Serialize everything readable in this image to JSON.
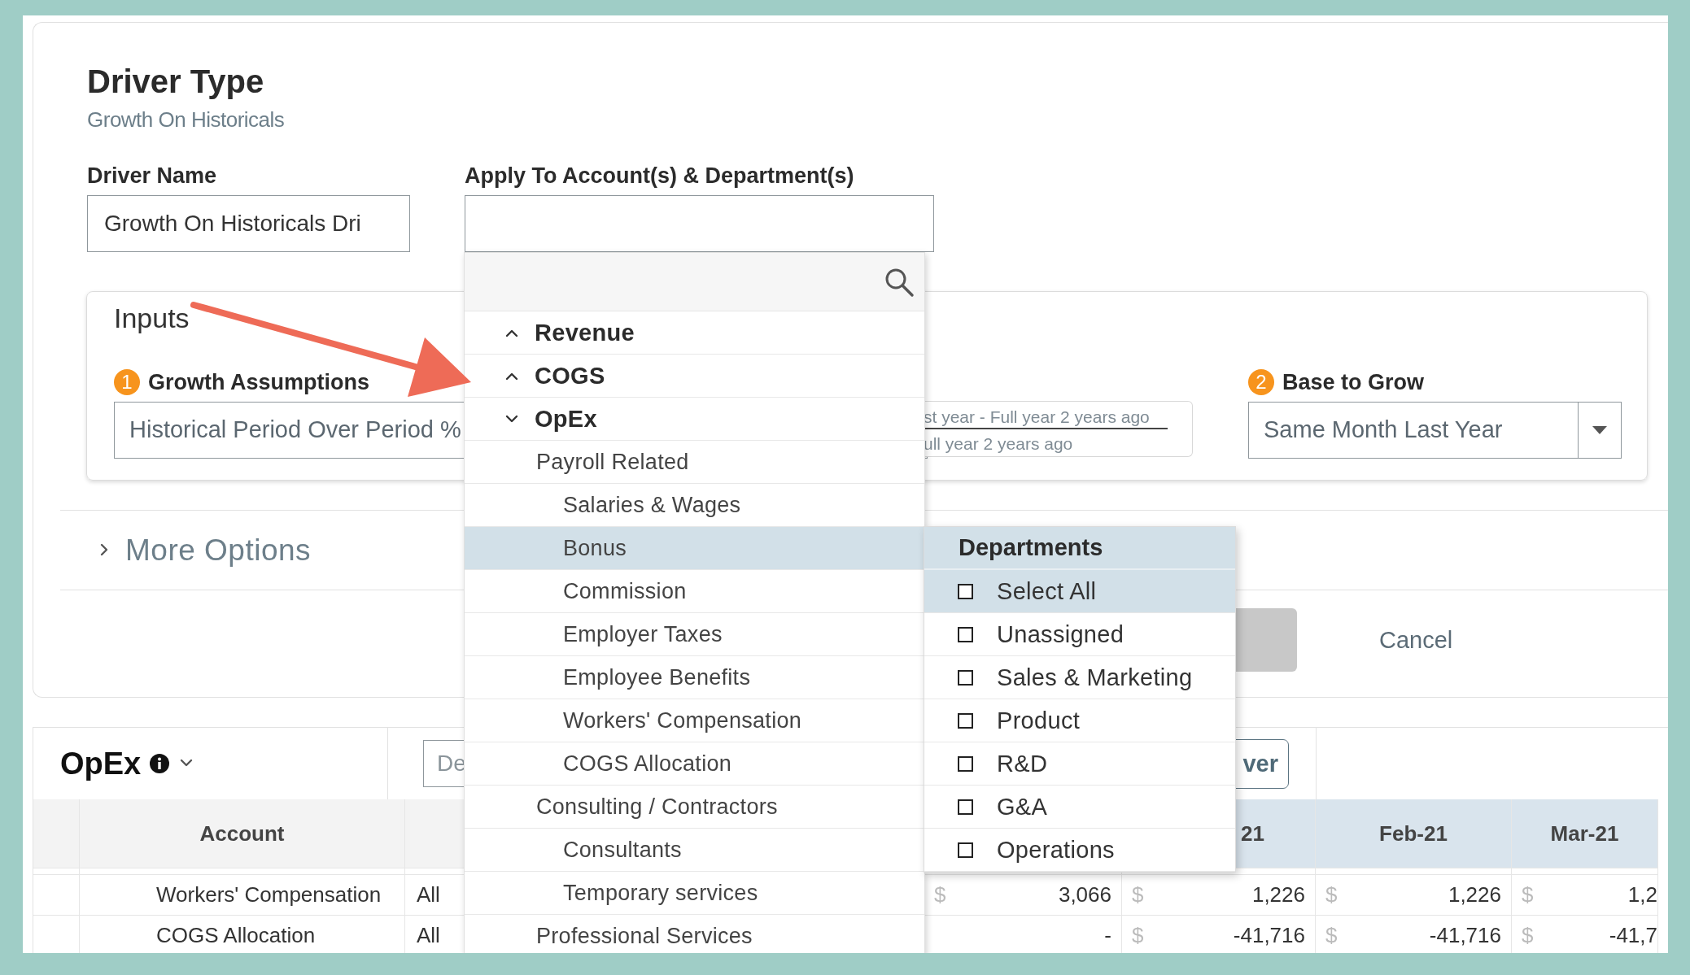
{
  "dialog": {
    "title": "Driver Type",
    "subtitle": "Growth On Historicals",
    "driver_name": {
      "label": "Driver Name",
      "value": "Growth On Historicals Dri"
    },
    "apply_to": {
      "label": "Apply To Account(s) & Department(s)"
    },
    "inputs": {
      "title": "Inputs",
      "growth_assumptions": {
        "step": "1",
        "label": "Growth Assumptions",
        "value": "Historical Period Over Period %"
      },
      "period_options": [
        "st year - Full year 2 years ago",
        "ull year 2 years ago"
      ],
      "base_to_grow": {
        "step": "2",
        "label": "Base to Grow",
        "value": "Same Month Last Year"
      }
    },
    "more_options": {
      "label": "More Options",
      "expanded": false
    },
    "cancel_button": "Cancel"
  },
  "account_dropdown": {
    "items": [
      {
        "label": "Revenue",
        "expanded": false,
        "selected": false
      },
      {
        "label": "COGS",
        "expanded": false,
        "selected": false
      },
      {
        "label": "OpEx",
        "expanded": true,
        "selected": false,
        "children": [
          {
            "label": "Payroll Related",
            "selected": false,
            "children": [
              {
                "label": "Salaries & Wages",
                "selected": false
              },
              {
                "label": "Bonus",
                "selected": true
              },
              {
                "label": "Commission",
                "selected": false
              },
              {
                "label": "Employer Taxes",
                "selected": false
              },
              {
                "label": "Employee Benefits",
                "selected": false
              },
              {
                "label": "Workers' Compensation",
                "selected": false
              },
              {
                "label": "COGS Allocation",
                "selected": false
              }
            ]
          },
          {
            "label": "Consulting / Contractors",
            "selected": false,
            "children": [
              {
                "label": "Consultants",
                "selected": false
              },
              {
                "label": "Temporary services",
                "selected": false
              }
            ]
          },
          {
            "label": "Professional Services",
            "selected": false
          }
        ]
      }
    ]
  },
  "departments_menu": {
    "title": "Departments",
    "items": [
      {
        "label": "Select All",
        "checked": false,
        "selected": true
      },
      {
        "label": "Unassigned",
        "checked": false,
        "selected": false
      },
      {
        "label": "Sales & Marketing",
        "checked": false,
        "selected": false
      },
      {
        "label": "Product",
        "checked": false,
        "selected": false
      },
      {
        "label": "R&D",
        "checked": false,
        "selected": false
      },
      {
        "label": "G&A",
        "checked": false,
        "selected": false
      },
      {
        "label": "Operations",
        "checked": false,
        "selected": false
      }
    ]
  },
  "opex": {
    "title": "OpEx",
    "search": {
      "placeholder": "De"
    },
    "action_button": "ver",
    "table": {
      "columns": [
        "Account",
        "21",
        "Feb-21",
        "Mar-21"
      ],
      "rows": [
        {
          "account": "Workers' Compensation",
          "scope": "All",
          "amounts": [
            {
              "currency": "$",
              "value": "3,066"
            },
            {
              "currency": "$",
              "value": "1,226"
            },
            {
              "currency": "$",
              "value": "1,226"
            },
            {
              "currency": "$",
              "value": "1,2"
            }
          ]
        },
        {
          "account": "COGS Allocation",
          "scope": "All",
          "amounts": [
            {
              "value": "-"
            },
            {
              "currency": "$",
              "value": "-41,716"
            },
            {
              "currency": "$",
              "value": "-41,716"
            },
            {
              "currency": "$",
              "value": "-41,7"
            }
          ]
        }
      ]
    }
  }
}
